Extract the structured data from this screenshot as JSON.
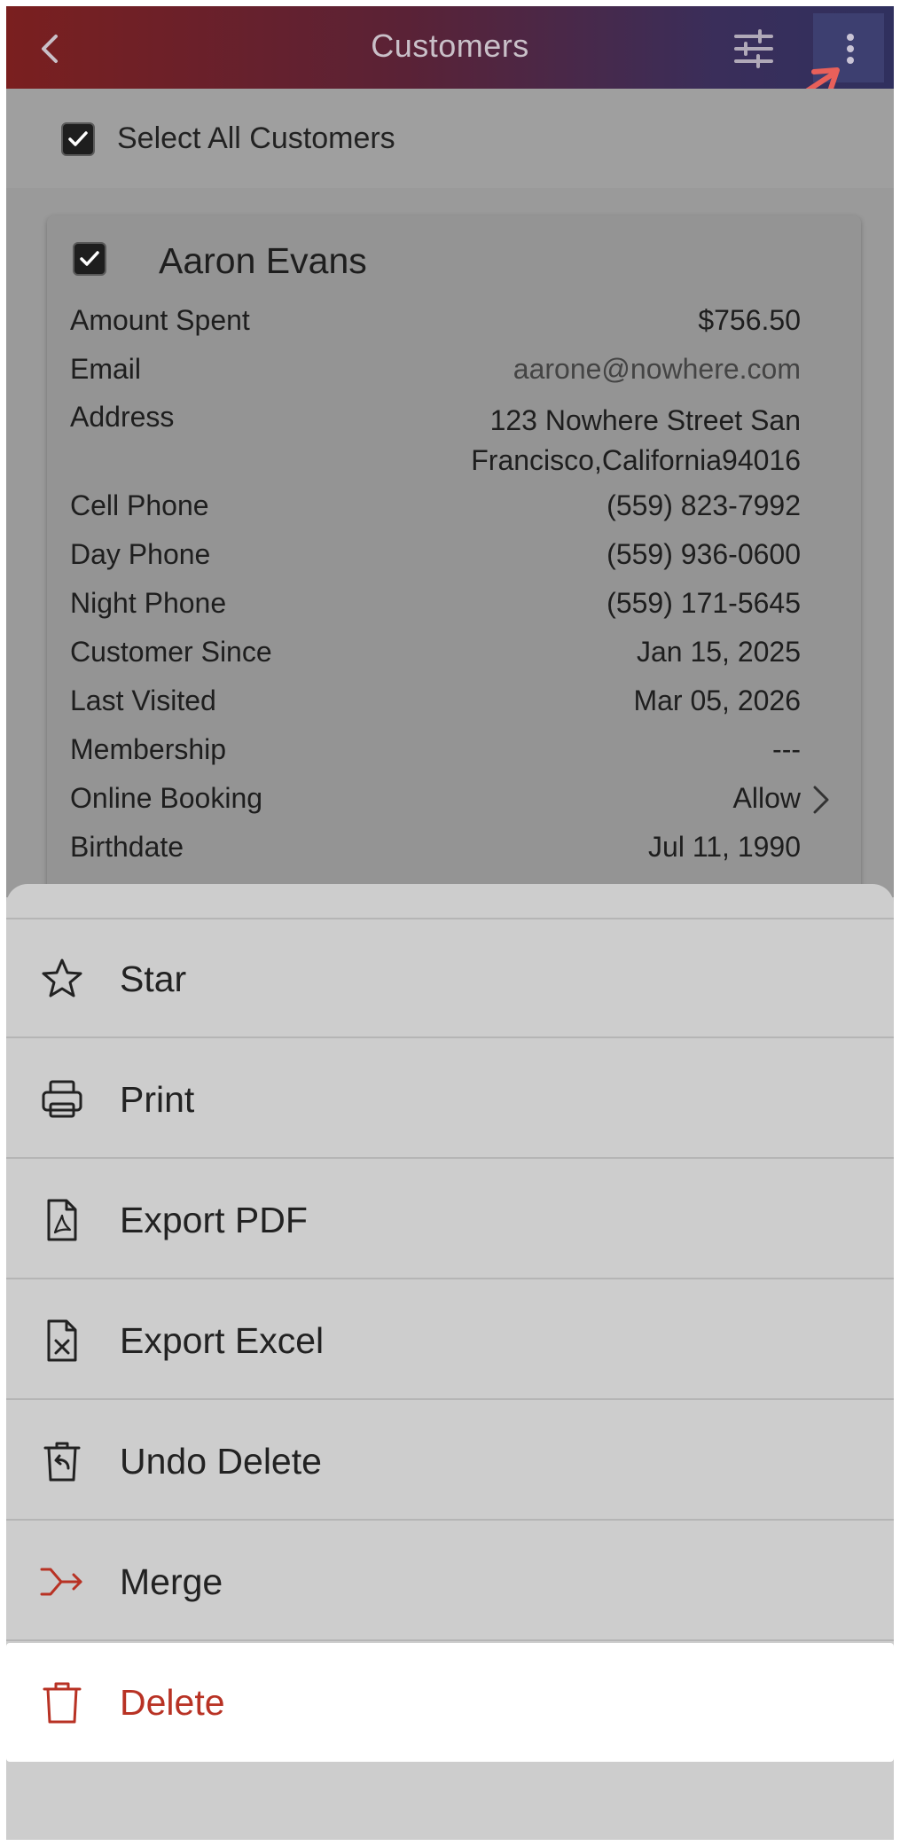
{
  "header": {
    "title": "Customers"
  },
  "select_all": {
    "label": "Select All Customers",
    "checked": true
  },
  "customer": {
    "name": "Aaron Evans",
    "checked": true,
    "fields": [
      {
        "label": "Amount Spent",
        "value": "$756.50"
      },
      {
        "label": "Email",
        "value": "aarone@nowhere.com"
      },
      {
        "label": "Address",
        "value": "123 Nowhere Street San Francisco,California94016"
      },
      {
        "label": "Cell Phone",
        "value": "(559) 823-7992"
      },
      {
        "label": "Day Phone",
        "value": "(559) 936-0600"
      },
      {
        "label": "Night Phone",
        "value": "(559) 171-5645"
      },
      {
        "label": "Customer Since",
        "value": "Jan 15, 2025"
      },
      {
        "label": "Last Visited",
        "value": "Mar 05, 2026"
      },
      {
        "label": "Membership",
        "value": "---"
      },
      {
        "label": "Online Booking",
        "value": "Allow"
      },
      {
        "label": "Birthdate",
        "value": "Jul 11, 1990"
      }
    ]
  },
  "menu": {
    "items": [
      {
        "label": "Star",
        "icon": "star-icon"
      },
      {
        "label": "Print",
        "icon": "printer-icon"
      },
      {
        "label": "Export PDF",
        "icon": "pdf-file-icon"
      },
      {
        "label": "Export Excel",
        "icon": "excel-file-icon"
      },
      {
        "label": "Undo Delete",
        "icon": "undo-delete-icon"
      },
      {
        "label": "Merge",
        "icon": "merge-icon"
      },
      {
        "label": "Delete",
        "icon": "trash-icon"
      }
    ]
  },
  "colors": {
    "delete_text": "#b83224",
    "merge_icon": "#b83224",
    "annotation_arrow": "#e8605a",
    "header_left": "#7a1f1f",
    "header_right": "#30305e"
  }
}
